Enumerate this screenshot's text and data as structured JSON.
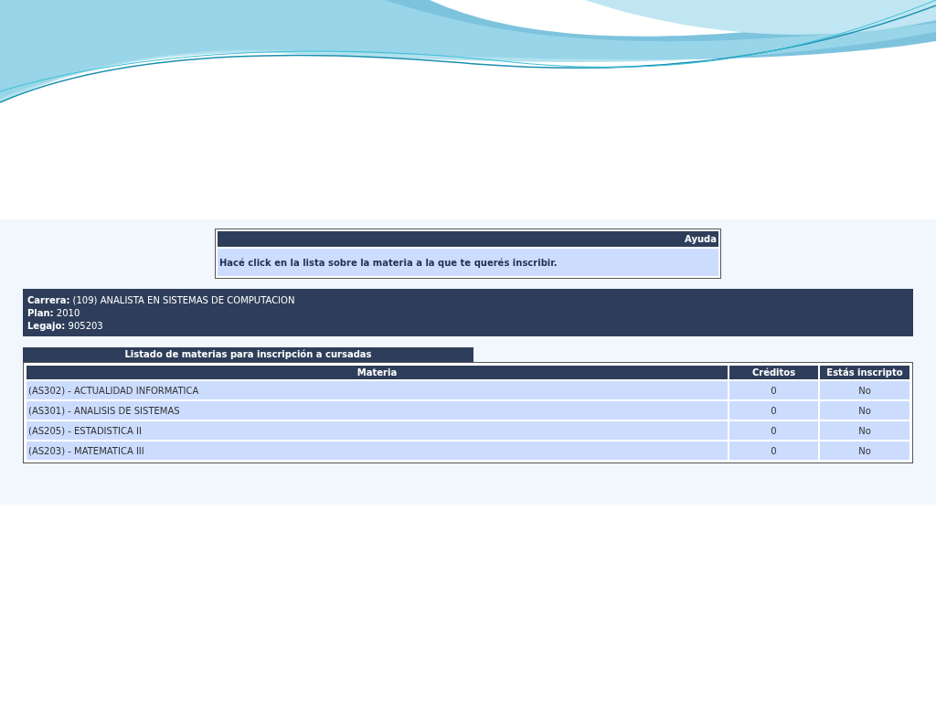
{
  "help": {
    "title": "Ayuda",
    "text": "Hacé click en la lista sobre la materia a la que te querés inscribir."
  },
  "info": [
    {
      "label": "Carrera:",
      "value": "(109) ANALISTA EN SISTEMAS DE COMPUTACION"
    },
    {
      "label": "Plan:",
      "value": "2010"
    },
    {
      "label": "Legajo:",
      "value": "905203"
    }
  ],
  "list_title": "Listado de materias para inscripción a cursadas",
  "table": {
    "columns": [
      "Materia",
      "Créditos",
      "Estás inscripto"
    ],
    "rows": [
      [
        "(AS302) - ACTUALIDAD INFORMATICA",
        "0",
        "No"
      ],
      [
        "(AS301) - ANALISIS DE SISTEMAS",
        "0",
        "No"
      ],
      [
        "(AS205) - ESTADISTICA II",
        "0",
        "No"
      ],
      [
        "(AS203) - MATEMATICA III",
        "0",
        "No"
      ]
    ]
  }
}
